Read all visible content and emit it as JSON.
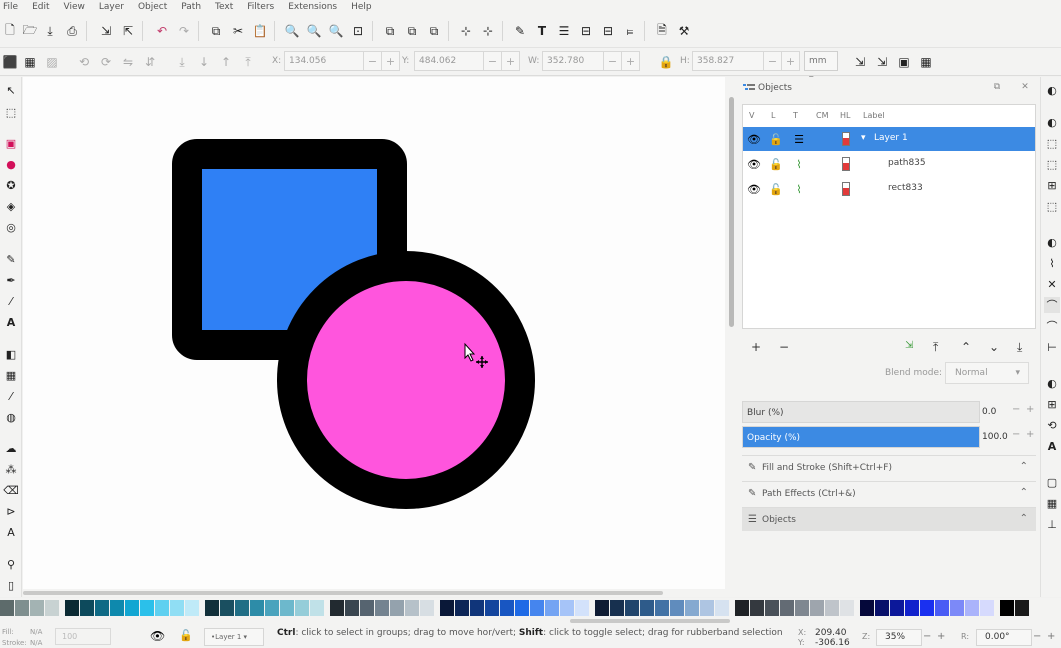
{
  "menu": [
    "File",
    "Edit",
    "View",
    "Layer",
    "Object",
    "Path",
    "Text",
    "Filters",
    "Extensions",
    "Help"
  ],
  "toolbar2": {
    "x_label": "X:",
    "x_value": "134.056",
    "y_label": "Y:",
    "y_value": "484.062",
    "w_label": "W:",
    "w_value": "352.780",
    "h_label": "H:",
    "h_value": "358.827",
    "unit": "mm"
  },
  "dock": {
    "title": "Objects",
    "columns": [
      "V",
      "L",
      "T",
      "CM",
      "HL",
      "Label"
    ],
    "rows": [
      {
        "label": "Layer 1",
        "selected": true
      },
      {
        "label": "path835",
        "selected": false
      },
      {
        "label": "rect833",
        "selected": false
      }
    ],
    "blend_label": "Blend mode:",
    "blend_value": "Normal",
    "blur_label": "Blur (%)",
    "blur_value": "0.0",
    "opacity_label": "Opacity (%)",
    "opacity_value": "100.0",
    "opacity_fraction": 1.0,
    "sections": [
      {
        "label": "Fill and Stroke (Shift+Ctrl+F)"
      },
      {
        "label": "Path Effects (Ctrl+&)"
      },
      {
        "label": "Objects"
      }
    ]
  },
  "canvas": {
    "square_fill": "#2f80f5",
    "circle_fill": "#ff55dd",
    "stroke": "#000000"
  },
  "status": {
    "fill_label": "Fill:",
    "fill_value": "N/A",
    "stroke_label": "Stroke:",
    "stroke_value": "N/A",
    "opacity_value": "100",
    "layer": "•Layer 1",
    "message_ctrl": "Ctrl",
    "message_ctrl_text": ": click to select in groups; drag to move hor/vert; ",
    "message_shift": "Shift",
    "message_shift_text": ": click to toggle select; drag for rubberband selection",
    "x_label": "X:",
    "x_value": "209.40",
    "y_label": "Y:",
    "y_value": "-306.16",
    "zoom_label": "Z:",
    "zoom_value": "35%",
    "rot_label": "R:",
    "rot_value": "0.00°"
  }
}
